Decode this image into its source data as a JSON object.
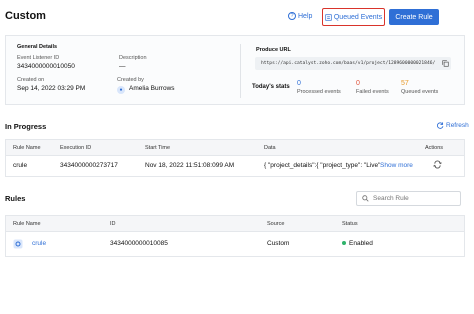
{
  "header": {
    "title": "Custom",
    "help_label": "Help",
    "queued_label": "Queued Events",
    "create_label": "Create Rule"
  },
  "general": {
    "section_title": "General Details",
    "listener_label": "Event Listener ID",
    "listener_value": "3434000000010050",
    "description_label": "Description",
    "description_value": "—",
    "created_on_label": "Created on",
    "created_on_value": "Sep 14, 2022 03:29 PM",
    "created_by_label": "Created by",
    "created_by_value": "Amelia Burrows"
  },
  "produce": {
    "label": "Produce URL",
    "url": "https://api.catalyst.zoho.com/baas/v1/project/1289600000021846/"
  },
  "stats": {
    "title": "Today's stats",
    "processed_value": "0",
    "processed_label": "Processed events",
    "failed_value": "0",
    "failed_label": "Failed events",
    "queued_value": "57",
    "queued_label": "Queued events",
    "processed_color": "#2f6fd6",
    "failed_color": "#e0543c",
    "queued_color": "#e79a2b"
  },
  "in_progress": {
    "title": "In Progress",
    "refresh_label": "Refresh",
    "columns": [
      "Rule Name",
      "Execution ID",
      "Start Time",
      "Data",
      "Actions"
    ],
    "rows": [
      {
        "rule_name": "crule",
        "execution_id": "3434000000273717",
        "start_time": "Nov 18, 2022 11:51:08:099 AM",
        "data": "{ \"project_details\":{ \"project_type\": \"Live\"...",
        "show_more": "Show more"
      }
    ]
  },
  "rules": {
    "title": "Rules",
    "search_placeholder": "Search Rule",
    "columns": [
      "Rule Name",
      "ID",
      "Source",
      "Status"
    ],
    "rows": [
      {
        "rule_name": "crule",
        "id": "3434000000010085",
        "source": "Custom",
        "status": "Enabled"
      }
    ]
  }
}
